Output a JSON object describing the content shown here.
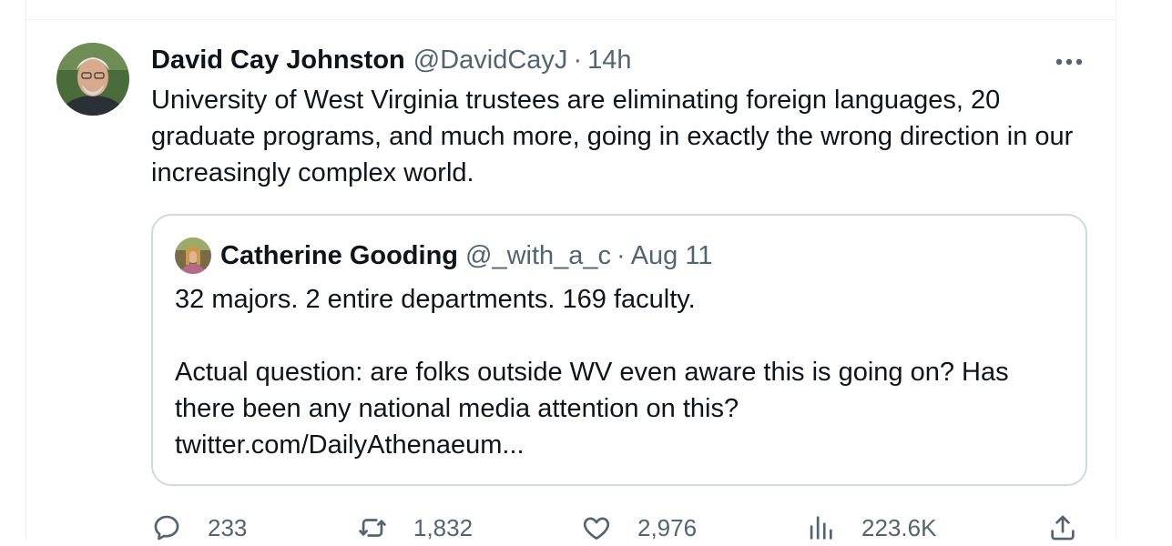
{
  "tweet": {
    "author_name": "David Cay Johnston",
    "author_handle": "@DavidCayJ",
    "separator": "·",
    "time": "14h",
    "text": "University of West Virginia trustees are eliminating foreign languages, 20 graduate programs, and much more, going in exactly the wrong direction in our increasingly complex world.",
    "more_icon": "more-horizontal-icon"
  },
  "quote": {
    "author_name": "Catherine Gooding",
    "author_handle": "@_with_a_c",
    "separator": "·",
    "time": "Aug 11",
    "line1": "32 majors. 2 entire departments. 169 faculty.",
    "line2": "Actual question: are folks outside WV even aware this is going on? Has there been any national media attention on this?",
    "line3": "twitter.com/DailyAthenaeum..."
  },
  "actions": {
    "reply": {
      "icon": "reply-icon",
      "count": "233"
    },
    "retweet": {
      "icon": "retweet-icon",
      "count": "1,832"
    },
    "like": {
      "icon": "heart-icon",
      "count": "2,976"
    },
    "views": {
      "icon": "analytics-icon",
      "count": "223.6K"
    },
    "share": {
      "icon": "share-icon"
    }
  },
  "colors": {
    "text_primary": "#0f1419",
    "text_secondary": "#536471",
    "border": "#cfd9de",
    "divider": "#eff3f4"
  }
}
